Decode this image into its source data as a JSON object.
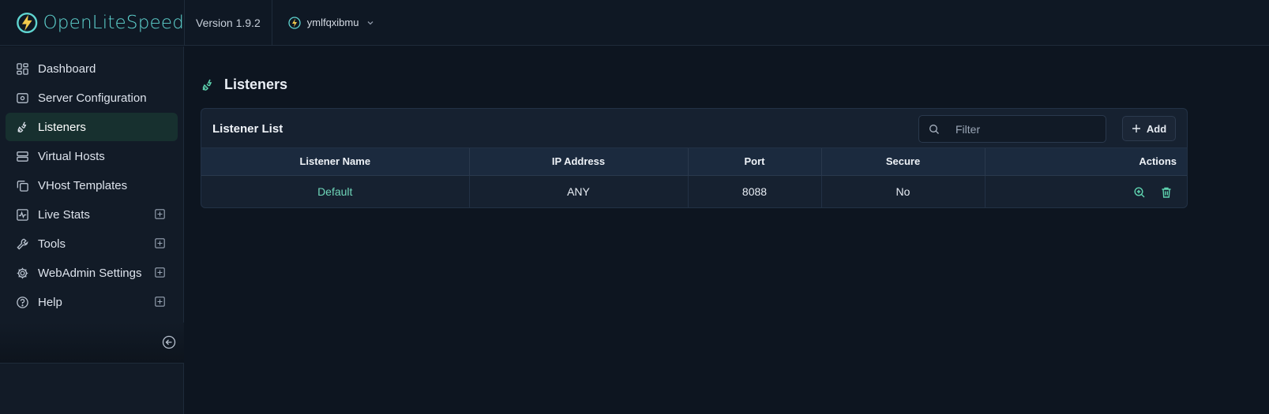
{
  "brand": {
    "name_part1": "Open",
    "name_part2": "LiteSpeed"
  },
  "version": "Version 1.9.2",
  "server": {
    "name": "ymlfqxibmu"
  },
  "sidebar": {
    "items": [
      {
        "label": "Dashboard",
        "icon": "dashboard-icon",
        "active": false,
        "expandable": false
      },
      {
        "label": "Server Configuration",
        "icon": "server-config-icon",
        "active": false,
        "expandable": false
      },
      {
        "label": "Listeners",
        "icon": "plug-icon",
        "active": true,
        "expandable": false
      },
      {
        "label": "Virtual Hosts",
        "icon": "server-stack-icon",
        "active": false,
        "expandable": false
      },
      {
        "label": "VHost Templates",
        "icon": "copy-icon",
        "active": false,
        "expandable": false
      },
      {
        "label": "Live Stats",
        "icon": "activity-icon",
        "active": false,
        "expandable": true
      },
      {
        "label": "Tools",
        "icon": "wrench-icon",
        "active": false,
        "expandable": true
      },
      {
        "label": "WebAdmin Settings",
        "icon": "gear-icon",
        "active": false,
        "expandable": true
      },
      {
        "label": "Help",
        "icon": "help-icon",
        "active": false,
        "expandable": true
      }
    ]
  },
  "page": {
    "title": "Listeners"
  },
  "card": {
    "title": "Listener List",
    "filter_placeholder": "Filter",
    "add_label": "Add"
  },
  "table": {
    "headers": [
      "Listener Name",
      "IP Address",
      "Port",
      "Secure",
      "Actions"
    ],
    "rows": [
      {
        "name": "Default",
        "ip": "ANY",
        "port": "8088",
        "secure": "No"
      }
    ]
  },
  "colors": {
    "accent": "#5fd4d0",
    "link": "#6fd6b9",
    "active_bg": "#17302f",
    "bolt": "#f2c94c"
  }
}
